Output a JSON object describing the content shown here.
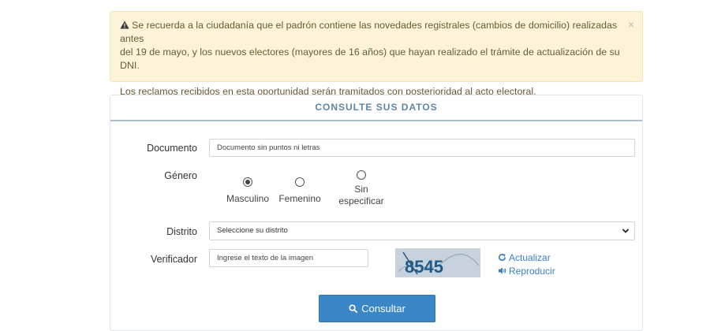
{
  "alert": {
    "paragraph1_line1": "Se recuerda a la ciudadanía que el padrón contiene las novedades registrales (cambios de domicilio) realizadas antes",
    "paragraph1_line2": "del 19 de mayo, y los nuevos electores (mayores de 16 años) que hayan realizado el trámite de actualización de su DNI.",
    "paragraph2": "Los reclamos recibidos en esta oportunidad serán tramitados con posterioridad al acto electoral.",
    "close_label": "×",
    "warning_icon": "warning-triangle-icon"
  },
  "form": {
    "title": "CONSULTE SUS DATOS",
    "documento": {
      "label": "Documento",
      "placeholder": "Documento sin puntos ni letras"
    },
    "genero": {
      "label": "Género",
      "options": [
        {
          "line1": "Masculino",
          "line2": "",
          "checked": true
        },
        {
          "line1": "Femenino",
          "line2": "",
          "checked": false
        },
        {
          "line1": "Sin",
          "line2": "especificar",
          "checked": false
        }
      ]
    },
    "distrito": {
      "label": "Distrito",
      "selected": "Seleccione su distrito"
    },
    "verificador": {
      "label": "Verificador",
      "placeholder": "Ingrese el texto de la imagen",
      "captcha_text": "8545",
      "refresh_label": "Actualizar",
      "audio_label": "Reproducir"
    },
    "submit_label": "Consultar"
  },
  "colors": {
    "alert_bg": "#fcf3d9",
    "header_text": "#5f85a6",
    "link": "#3b7dc5",
    "button": "#3b86c6"
  }
}
